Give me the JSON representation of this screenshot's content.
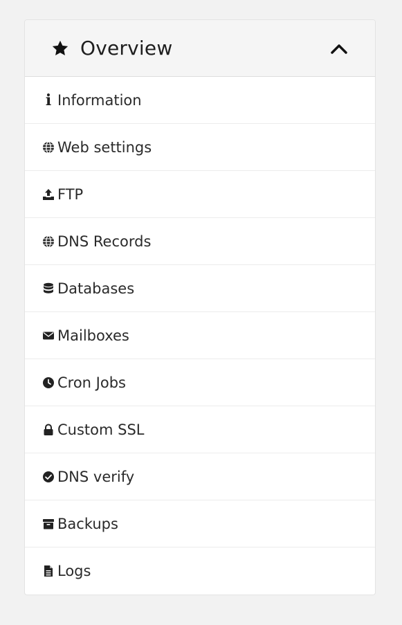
{
  "panel": {
    "title": "Overview",
    "title_icon": "star-icon",
    "toggle_icon": "chevron-up-icon"
  },
  "menu": [
    {
      "label": "Information",
      "icon": "info-icon"
    },
    {
      "label": "Web settings",
      "icon": "globe-icon"
    },
    {
      "label": "FTP",
      "icon": "upload-icon"
    },
    {
      "label": "DNS Records",
      "icon": "globe-icon"
    },
    {
      "label": "Databases",
      "icon": "database-icon"
    },
    {
      "label": "Mailboxes",
      "icon": "envelope-icon"
    },
    {
      "label": "Cron Jobs",
      "icon": "clock-icon"
    },
    {
      "label": "Custom SSL",
      "icon": "lock-icon"
    },
    {
      "label": "DNS verify",
      "icon": "check-circle-icon"
    },
    {
      "label": "Backups",
      "icon": "archive-icon"
    },
    {
      "label": "Logs",
      "icon": "file-icon"
    }
  ],
  "colors": {
    "background": "#f2f2f2",
    "panel": "#ffffff",
    "header": "#f5f5f5",
    "icon": "#222222"
  }
}
